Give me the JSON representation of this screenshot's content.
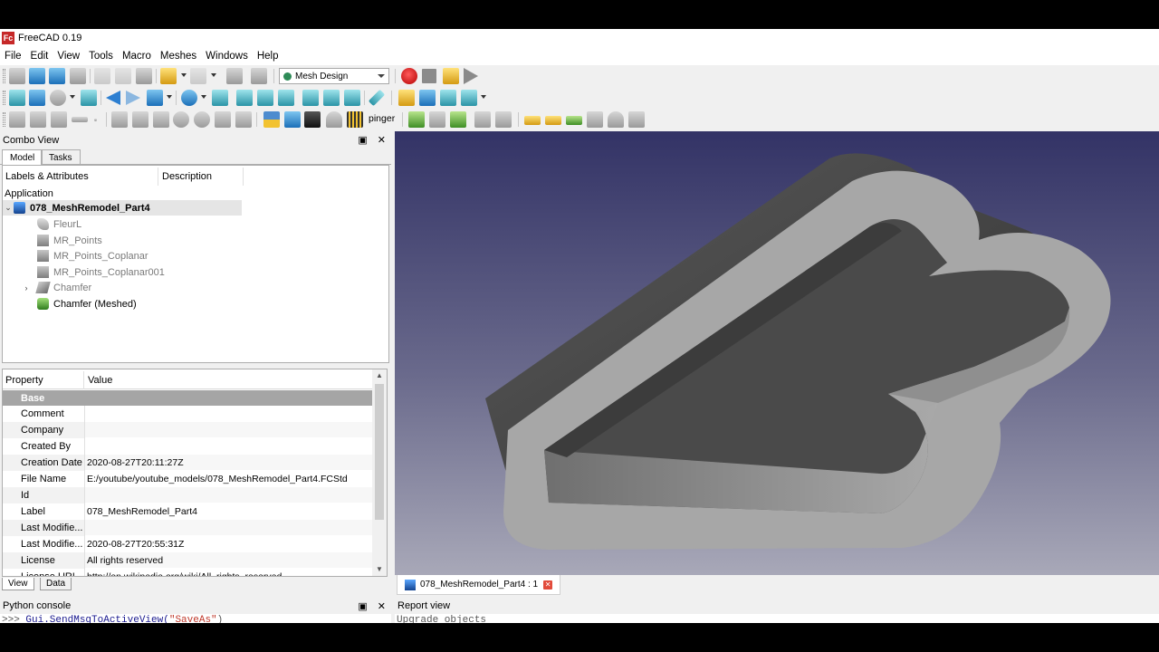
{
  "window": {
    "title": "FreeCAD 0.19",
    "logo_text": "Fc"
  },
  "menu": [
    "File",
    "Edit",
    "View",
    "Tools",
    "Macro",
    "Meshes",
    "Windows",
    "Help"
  ],
  "toolbar": {
    "workbench": "Mesh Design",
    "pinger_label": "pinger"
  },
  "combo_view": {
    "title": "Combo View",
    "header_buttons": {
      "float": "▣",
      "close": "✕"
    },
    "tabs": [
      "Model",
      "Tasks"
    ],
    "tree": {
      "headers": [
        "Labels & Attributes",
        "Description"
      ],
      "section": "Application",
      "document": "078_MeshRemodel_Part4",
      "items": [
        {
          "label": "FleurL",
          "icon": "fleur-icon"
        },
        {
          "label": "MR_Points",
          "icon": "box-icon"
        },
        {
          "label": "MR_Points_Coplanar",
          "icon": "box-icon"
        },
        {
          "label": "MR_Points_Coplanar001",
          "icon": "box-icon"
        },
        {
          "label": "Chamfer",
          "icon": "chamfer-icon"
        },
        {
          "label": "Chamfer (Meshed)",
          "icon": "mesh-icon"
        }
      ]
    },
    "properties": {
      "headers": [
        "Property",
        "Value"
      ],
      "group": "Base",
      "rows": [
        {
          "name": "Comment",
          "value": ""
        },
        {
          "name": "Company",
          "value": ""
        },
        {
          "name": "Created By",
          "value": ""
        },
        {
          "name": "Creation Date",
          "value": "2020-08-27T20:11:27Z"
        },
        {
          "name": "File Name",
          "value": "E:/youtube/youtube_models/078_MeshRemodel_Part4.FCStd"
        },
        {
          "name": "Id",
          "value": ""
        },
        {
          "name": "Label",
          "value": "078_MeshRemodel_Part4"
        },
        {
          "name": "Last Modifie...",
          "value": ""
        },
        {
          "name": "Last Modifie...",
          "value": "2020-08-27T20:55:31Z"
        },
        {
          "name": "License",
          "value": "All rights reserved"
        },
        {
          "name": "License URL",
          "value": "http://en.wikipedia.org/wiki/All_rights_reserved"
        }
      ]
    },
    "bottom_tabs": [
      "View",
      "Data"
    ]
  },
  "viewport": {
    "doc_tab": "078_MeshRemodel_Part4 : 1"
  },
  "python_console": {
    "title": "Python console",
    "prompt": ">>> ",
    "line_obj": "Gui.SendMsgToActiveView(",
    "line_str": "\"SaveAs\"",
    "line_end": ")"
  },
  "report_view": {
    "title": "Report view",
    "line": "Upgrade objects"
  },
  "colors": {
    "selected_group": "#a5a5a5",
    "viewport_top": "#333366",
    "viewport_bottom": "#a8a8b8"
  }
}
